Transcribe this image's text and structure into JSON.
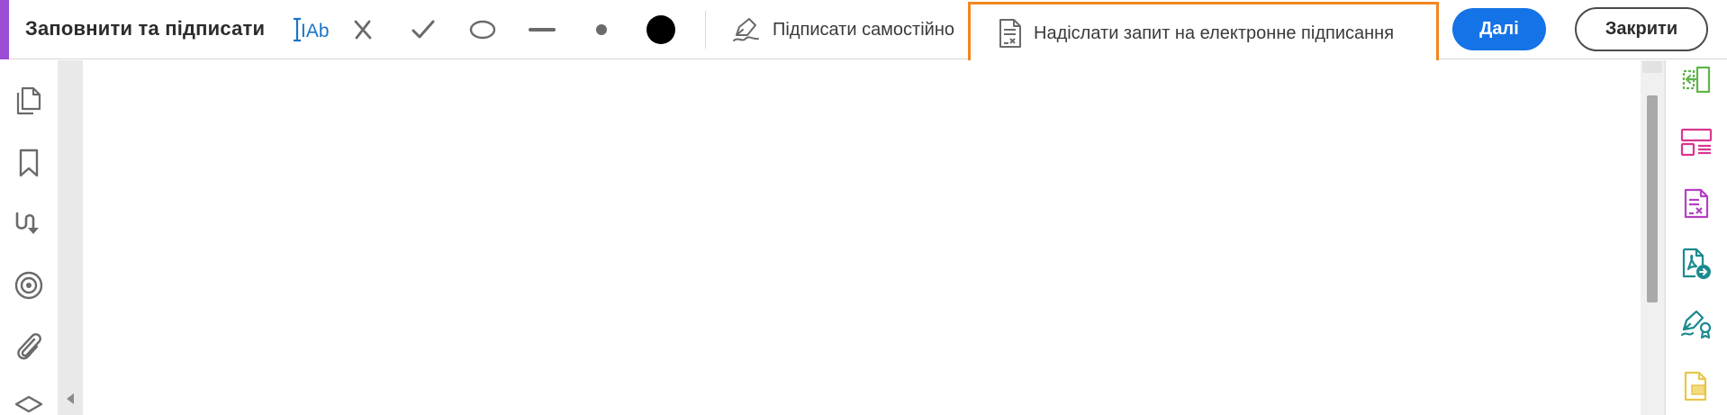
{
  "toolbar": {
    "title": "Заповнити та підписати",
    "tools": [
      {
        "icon": "text-field-icon",
        "label": "IAb"
      },
      {
        "icon": "cross-mark-icon"
      },
      {
        "icon": "check-mark-icon"
      },
      {
        "icon": "ellipse-icon"
      },
      {
        "icon": "line-icon"
      },
      {
        "icon": "small-dot-icon"
      },
      {
        "icon": "color-swatch-icon"
      }
    ],
    "sign_self_label": "Підписати самостійно",
    "request_signature_label": "Надіслати запит на електронне підписання",
    "next_label": "Далі",
    "close_label": "Закрити"
  },
  "left_sidebar": {
    "icons": [
      "page-thumbnails-icon",
      "bookmark-icon",
      "signatures-panel-icon",
      "layers-target-icon",
      "attachment-icon",
      "layers-stack-icon"
    ]
  },
  "right_panel": {
    "icons": [
      "export-pdf-icon",
      "organize-pages-icon",
      "edit-pdf-icon",
      "share-pdf-icon",
      "fill-sign-icon",
      "comment-icon"
    ]
  },
  "colors": {
    "accent_strip": "#9b4dd6",
    "highlight_border": "#f2861f",
    "primary_button": "#1473e6",
    "tool_blue": "#1a73c8"
  }
}
